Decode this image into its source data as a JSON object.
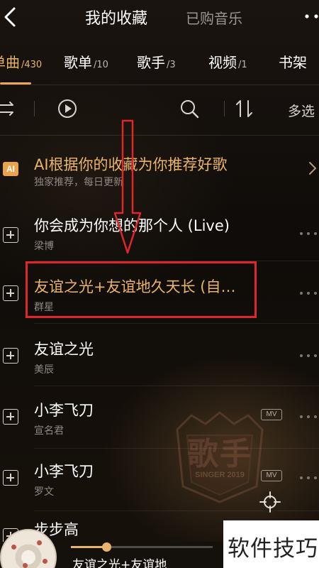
{
  "header": {
    "title": "我的收藏",
    "purchased_tab": "已购音乐"
  },
  "tabs": [
    {
      "label": "单曲",
      "count": "/430",
      "active": true
    },
    {
      "label": "歌单",
      "count": "/10"
    },
    {
      "label": "歌手",
      "count": "/3"
    },
    {
      "label": "视频",
      "count": "/1"
    },
    {
      "label": "书架",
      "count": ""
    }
  ],
  "toolbar": {
    "icons": [
      "shuffle-icon",
      "play-circle-icon",
      "search-icon",
      "sort-icon"
    ],
    "multi_select_label": "多选"
  },
  "ai_recommend": {
    "badge": "AI",
    "title": "AI根据你的收藏为你推荐好歌",
    "subtitle": "独家推荐，每日更新"
  },
  "songs": [
    {
      "title": "你会成为你想的那个人 (Live)",
      "artist": "梁博",
      "mv": ""
    },
    {
      "title": "友谊之光+友谊地久天长 (自…",
      "artist": "群星",
      "mv": "",
      "highlighted": true
    },
    {
      "title": "友谊之光",
      "artist": "美辰",
      "mv": ""
    },
    {
      "title": "小李飞刀",
      "artist": "宣名君",
      "mv": "MV"
    },
    {
      "title": "小李飞刀",
      "artist": "罗文",
      "mv": "MV"
    },
    {
      "title": "步步高",
      "artist": "",
      "mv": ""
    }
  ],
  "player": {
    "now_playing": "友谊之光+友谊地",
    "progress": 0.25
  },
  "background_emblem": {
    "text": "歌手",
    "sub": "SINGER 2019"
  },
  "watermark": "软件技巧",
  "colors": {
    "accent": "#e8b46b",
    "highlight_box": "#e0262d",
    "ai_badge": "#e9a24e"
  }
}
